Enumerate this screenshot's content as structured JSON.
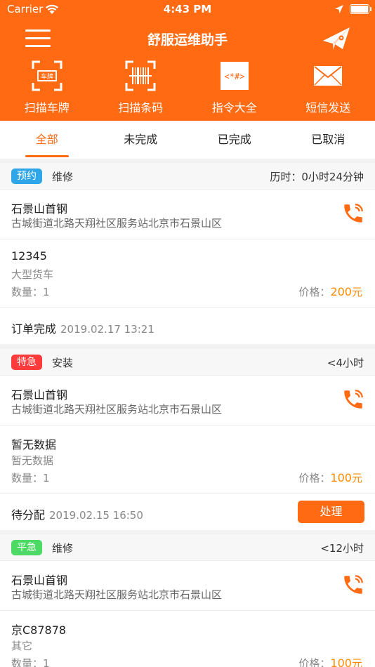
{
  "status_bar": {
    "carrier": "Carrier",
    "time": "4:43 PM"
  },
  "navbar": {
    "title": "舒服运维助手"
  },
  "tools": [
    {
      "label": "扫描车牌",
      "icon": "license-plate-scan-icon",
      "icon_text": "车牌"
    },
    {
      "label": "扫描条码",
      "icon": "barcode-scan-icon"
    },
    {
      "label": "指令大全",
      "icon": "command-list-icon",
      "icon_text": "<*#>"
    },
    {
      "label": "短信发送",
      "icon": "envelope-icon"
    }
  ],
  "tabs": [
    {
      "label": "全部",
      "active": true
    },
    {
      "label": "未完成",
      "active": false
    },
    {
      "label": "已完成",
      "active": false
    },
    {
      "label": "已取消",
      "active": false
    }
  ],
  "colors": {
    "brand": "#ff6a13",
    "price": "#ff8a00",
    "badge_appointment": "#2fa6e8",
    "badge_urgent": "#ff3b3b",
    "badge_normal": "#4cd964"
  },
  "orders": [
    {
      "badge": "预约",
      "type": "维修",
      "duration": "历时：0小时24分钟",
      "name": "石景山首钢",
      "address": "古城街道北路天翔社区服务站北京市石景山区",
      "plate": "12345",
      "vehicle_type": "大型货车",
      "quantity": "数量：1",
      "price_label": "价格：",
      "price": "200",
      "price_unit": "元",
      "state": "订单完成",
      "date": "2019.02.17 13:21"
    },
    {
      "badge": "特急",
      "type": "安装",
      "duration": "<4小时",
      "name": "石景山首钢",
      "address": "古城街道北路天翔社区服务站北京市石景山区",
      "plate": "暂无数据",
      "vehicle_type": "暂无数据",
      "quantity": "数量：1",
      "price_label": "价格：",
      "price": "100",
      "price_unit": "元",
      "state": "待分配",
      "date": "2019.02.15 16:50",
      "action_label": "处理"
    },
    {
      "badge": "平急",
      "type": "维修",
      "duration": "<12小时",
      "name": "石景山首钢",
      "address": "古城街道北路天翔社区服务站北京市石景山区",
      "plate": "京C87878",
      "vehicle_type": "其它",
      "quantity": "数量：1",
      "price_label": "价格：",
      "price": "100",
      "price_unit": "元"
    }
  ]
}
